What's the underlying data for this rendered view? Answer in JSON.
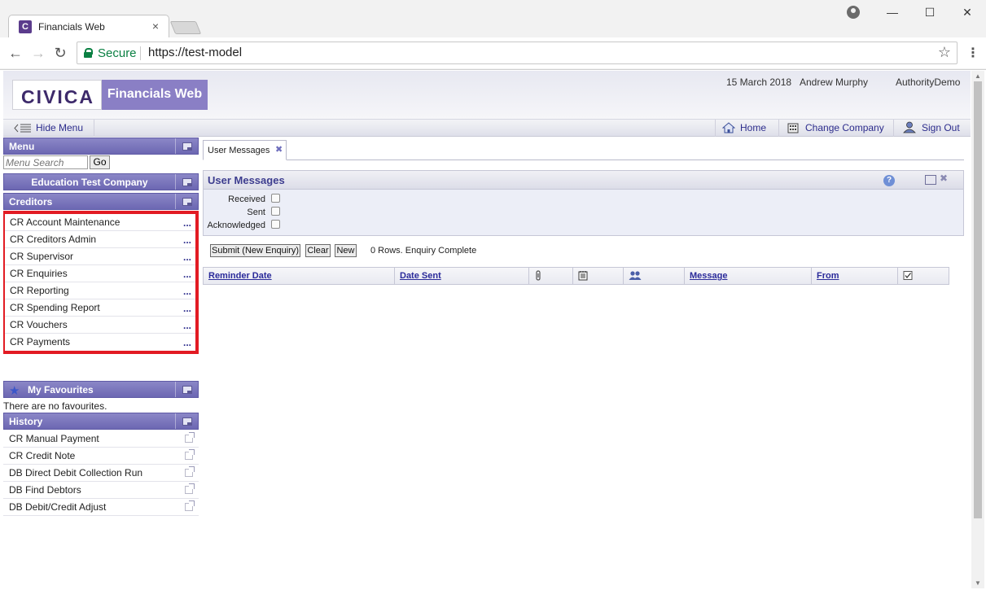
{
  "browser": {
    "tab_title": "Financials Web",
    "tab_favicon": "C",
    "tab_close": "×",
    "secure_label": "Secure",
    "url": "https://test-model"
  },
  "header": {
    "logo_text": "CIVICA",
    "app_name": "Financials Web",
    "date": "15 March 2018",
    "user": "Andrew Murphy",
    "authority": "AuthorityDemo"
  },
  "topbar": {
    "hide_menu": "Hide Menu",
    "home": "Home",
    "change_company": "Change Company",
    "sign_out": "Sign Out"
  },
  "menu": {
    "title": "Menu",
    "search_placeholder": "Menu Search",
    "go_label": "Go",
    "company": "Education Test Company",
    "section": "Creditors",
    "items": [
      {
        "label": "CR Account Maintenance"
      },
      {
        "label": "CR Creditors Admin"
      },
      {
        "label": "CR Supervisor"
      },
      {
        "label": "CR Enquiries"
      },
      {
        "label": "CR Reporting"
      },
      {
        "label": "CR Spending Report"
      },
      {
        "label": "CR Vouchers"
      },
      {
        "label": "CR Payments"
      }
    ],
    "more_glyph": "..."
  },
  "favourites": {
    "title": "My Favourites",
    "empty_text": "There are no favourites."
  },
  "history": {
    "title": "History",
    "items": [
      {
        "label": "CR Manual Payment"
      },
      {
        "label": "CR Credit Note"
      },
      {
        "label": "DB Direct Debit Collection Run"
      },
      {
        "label": "DB Find Debtors"
      },
      {
        "label": "DB Debit/Credit Adjust"
      }
    ]
  },
  "main": {
    "tab_label": "User Messages",
    "panel_title": "User Messages",
    "filters": [
      "Received",
      "Sent",
      "Acknowledged"
    ],
    "buttons": {
      "submit": "Submit (New Enquiry)",
      "clear": "Clear",
      "new": "New"
    },
    "status": "0 Rows. Enquiry Complete",
    "columns": {
      "reminder_date": "Reminder Date",
      "date_sent": "Date Sent",
      "message": "Message",
      "from": "From"
    }
  },
  "colors": {
    "brand_purple": "#8a7fc5",
    "panel_header": "#6c67b2",
    "highlight_border": "#e21b23",
    "link_blue": "#2c2c8c"
  }
}
